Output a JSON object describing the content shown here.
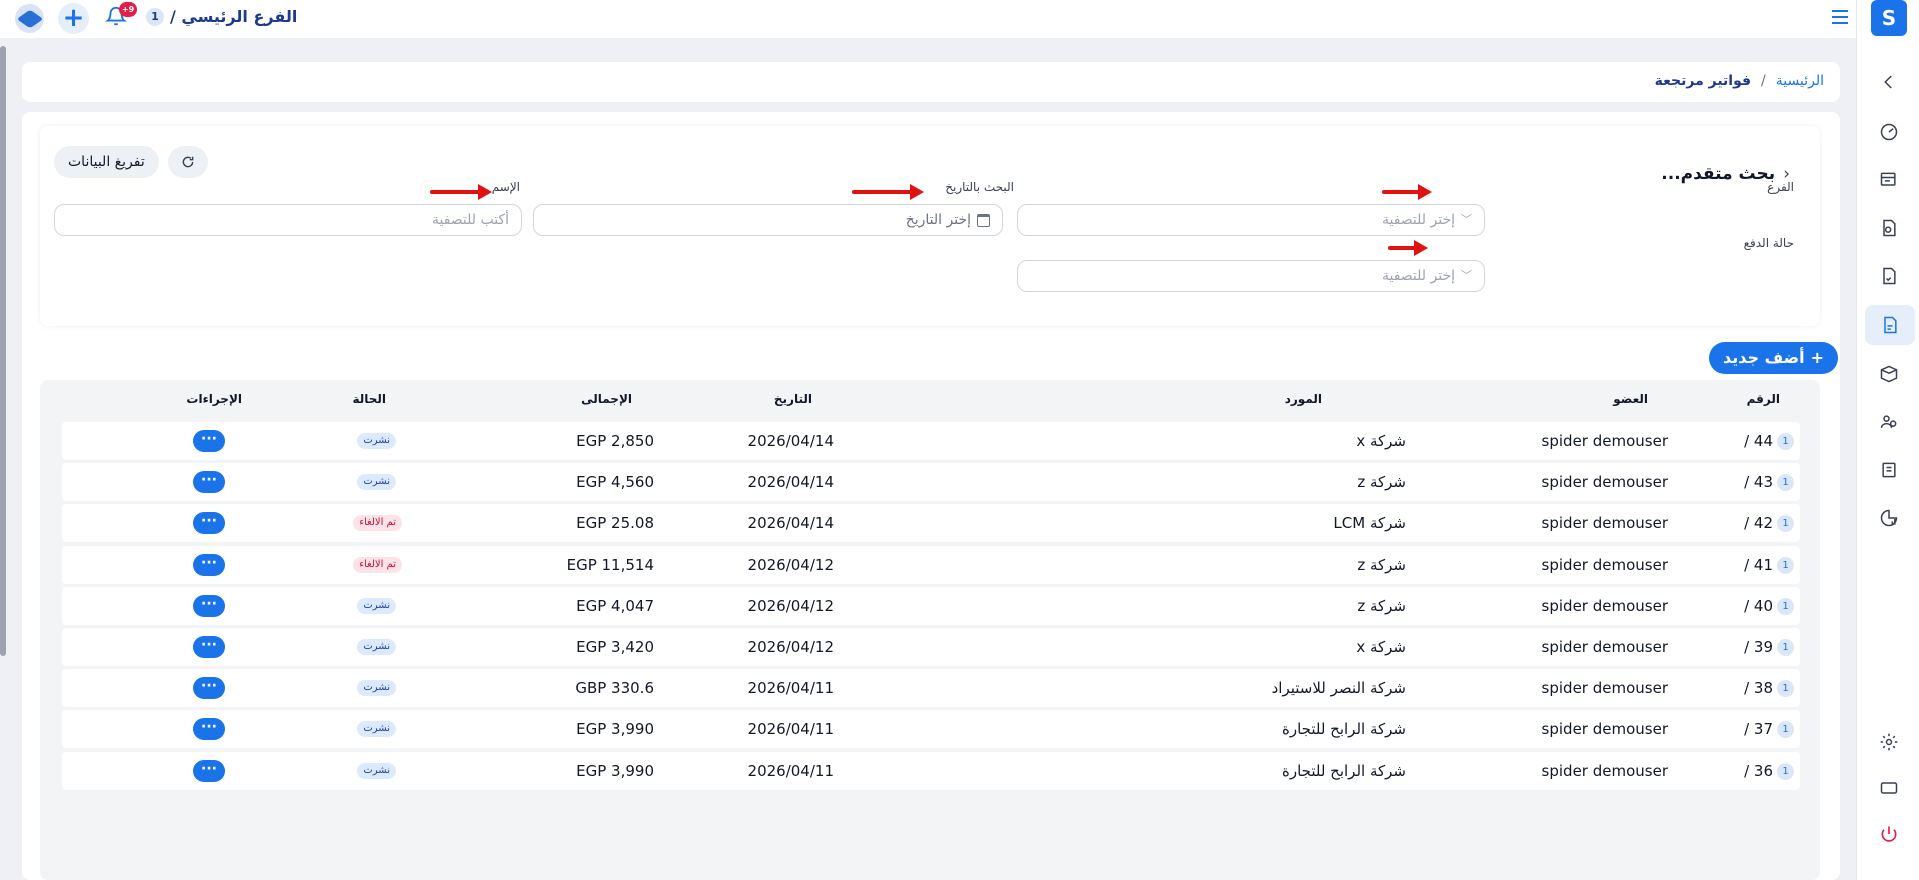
{
  "topbar": {
    "branch_title": "الفرع الرئيسي /",
    "branch_number": "1",
    "notification_count": "+9"
  },
  "breadcrumb": {
    "home": "الرئيسية",
    "separator": "/",
    "current": "فواتير مرتجعة"
  },
  "search": {
    "title": "بحث متقدم...",
    "clear_label": "تفريغ البيانات",
    "fields": {
      "branch_label": "الفرع",
      "branch_placeholder": "إختر للتصفية",
      "date_label": "البحث بالتاريخ",
      "date_placeholder": "إختر التاريخ",
      "name_label": "الإسم",
      "name_placeholder": "أكتب للتصفية",
      "payment_label": "حالة الدفع",
      "payment_placeholder": "إختر للتصفية"
    }
  },
  "add_button": "أضف جديد",
  "table": {
    "headers": {
      "number": "الرقم",
      "member": "العضو",
      "supplier": "المورد",
      "date": "التاريخ",
      "total": "الإجمالى",
      "status": "الحالة",
      "actions": "الإجراءات"
    },
    "rows": [
      {
        "number": "44 /",
        "branch": "1",
        "member": "spider demouser",
        "supplier": "شركة x",
        "date": "2026/04/14",
        "total": "EGP 2,850",
        "status": "نشرت",
        "status_type": "published"
      },
      {
        "number": "43 /",
        "branch": "1",
        "member": "spider demouser",
        "supplier": "شركة z",
        "date": "2026/04/14",
        "total": "EGP 4,560",
        "status": "نشرت",
        "status_type": "published"
      },
      {
        "number": "42 /",
        "branch": "1",
        "member": "spider demouser",
        "supplier": "شركة LCM",
        "date": "2026/04/14",
        "total": "EGP 25.08",
        "status": "تم الالغاء",
        "status_type": "cancelled"
      },
      {
        "number": "41 /",
        "branch": "1",
        "member": "spider demouser",
        "supplier": "شركة z",
        "date": "2026/04/12",
        "total": "EGP 11,514",
        "status": "تم الالغاء",
        "status_type": "cancelled"
      },
      {
        "number": "40 /",
        "branch": "1",
        "member": "spider demouser",
        "supplier": "شركة z",
        "date": "2026/04/12",
        "total": "EGP 4,047",
        "status": "نشرت",
        "status_type": "published"
      },
      {
        "number": "39 /",
        "branch": "1",
        "member": "spider demouser",
        "supplier": "شركة x",
        "date": "2026/04/12",
        "total": "EGP 3,420",
        "status": "نشرت",
        "status_type": "published"
      },
      {
        "number": "38 /",
        "branch": "1",
        "member": "spider demouser",
        "supplier": "شركة النصر للاستيراد",
        "date": "2026/04/11",
        "total": "GBP 330.6",
        "status": "نشرت",
        "status_type": "published"
      },
      {
        "number": "37 /",
        "branch": "1",
        "member": "spider demouser",
        "supplier": "شركة الرابح للتجارة",
        "date": "2026/04/11",
        "total": "EGP 3,990",
        "status": "نشرت",
        "status_type": "published"
      },
      {
        "number": "36 /",
        "branch": "1",
        "member": "spider demouser",
        "supplier": "شركة الرابح للتجارة",
        "date": "2026/04/11",
        "total": "EGP 3,990",
        "status": "نشرت",
        "status_type": "published"
      }
    ],
    "actions_label": "···"
  },
  "colors": {
    "accent": "#1a73e8",
    "annotation_arrow": "#e0110f",
    "status_cancelled": "#be123c"
  }
}
